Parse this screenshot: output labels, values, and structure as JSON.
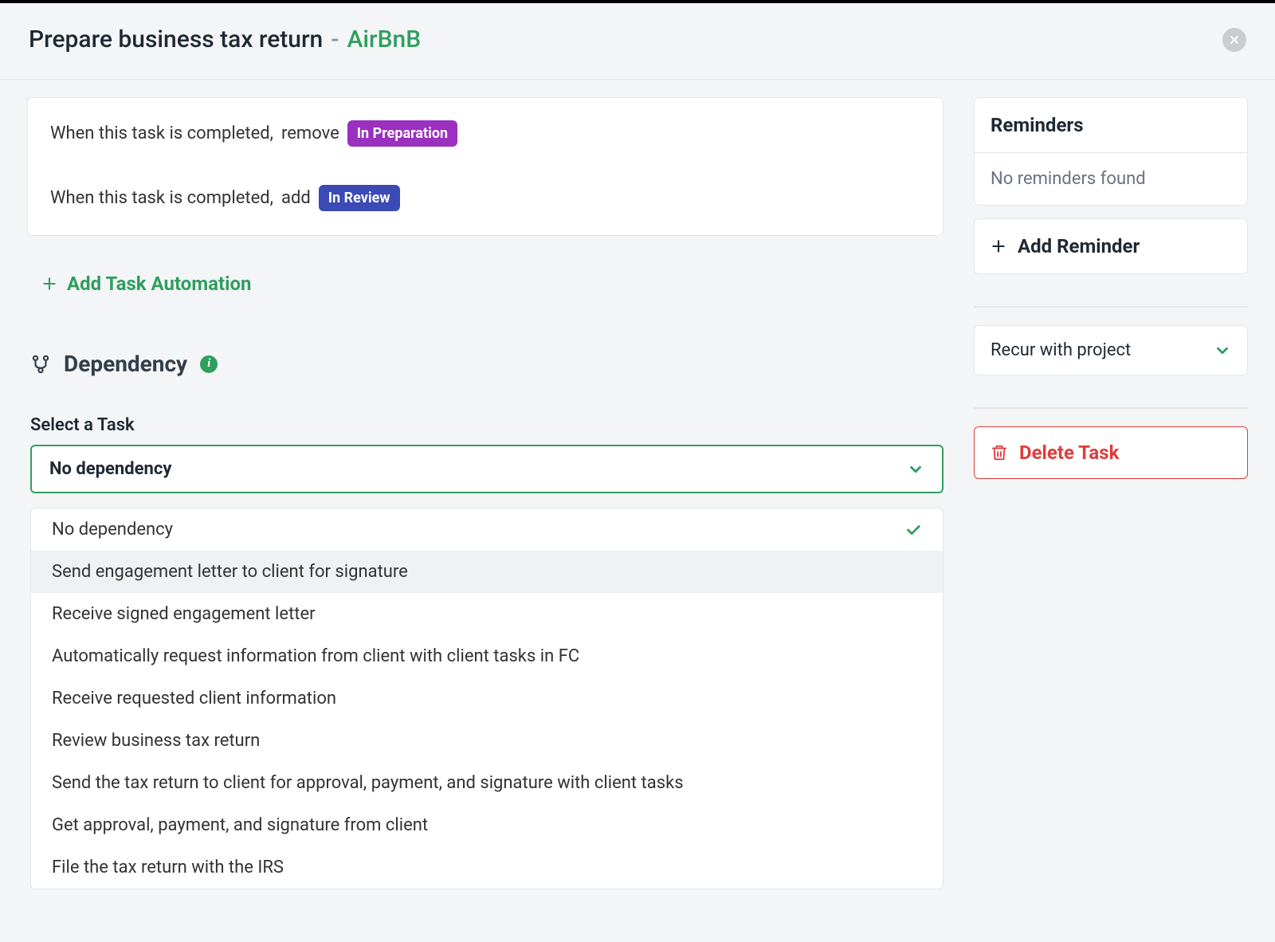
{
  "header": {
    "taskName": "Prepare business tax return",
    "dash": "-",
    "clientName": "AirBnB"
  },
  "automation": {
    "lines": [
      {
        "prefix": "When this task is completed,",
        "action": "remove",
        "tag": "In Preparation",
        "tagClass": "tag-purple"
      },
      {
        "prefix": "When this task is completed,",
        "action": "add",
        "tag": "In Review",
        "tagClass": "tag-indigo"
      }
    ],
    "addLabel": "Add Task Automation"
  },
  "dependency": {
    "heading": "Dependency",
    "selectLabel": "Select a Task",
    "selectedValue": "No dependency",
    "options": [
      {
        "label": "No dependency",
        "selected": true,
        "hovered": false
      },
      {
        "label": "Send engagement letter to client for signature",
        "selected": false,
        "hovered": true
      },
      {
        "label": "Receive signed engagement letter",
        "selected": false,
        "hovered": false
      },
      {
        "label": "Automatically request information from client with client tasks in FC",
        "selected": false,
        "hovered": false
      },
      {
        "label": "Receive requested client information",
        "selected": false,
        "hovered": false
      },
      {
        "label": "Review business tax return",
        "selected": false,
        "hovered": false
      },
      {
        "label": "Send the tax return to client for approval, payment, and signature with client tasks",
        "selected": false,
        "hovered": false
      },
      {
        "label": "Get approval, payment, and signature from client",
        "selected": false,
        "hovered": false
      },
      {
        "label": "File the tax return with the IRS",
        "selected": false,
        "hovered": false
      }
    ]
  },
  "side": {
    "remindersTitle": "Reminders",
    "remindersEmpty": "No reminders found",
    "addReminder": "Add Reminder",
    "recur": "Recur with project",
    "delete": "Delete Task"
  }
}
